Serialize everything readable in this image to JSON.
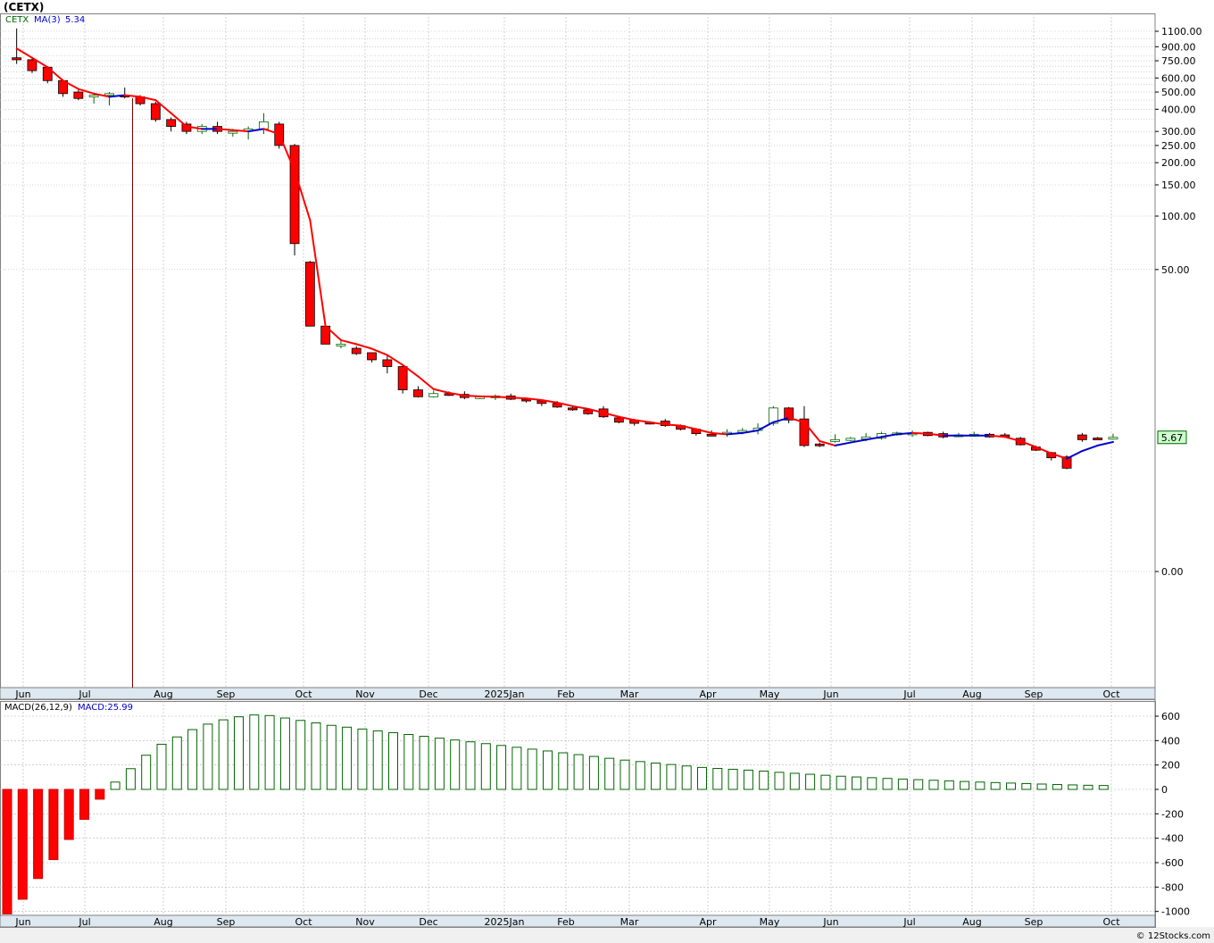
{
  "title": "(CETX)",
  "footer": "© 12Stocks.com",
  "colors": {
    "down": "#ff0000",
    "up": "#ffffff",
    "ma_down": "#ff0000",
    "ma_up": "#0000cc",
    "macd": "#006600",
    "grid": "#b4b4b4"
  },
  "price_legend": {
    "ticker": "CETX",
    "ma_label": "MA(3)",
    "ma_value": "5.34"
  },
  "macd_legend": {
    "label": "MACD(26,12,9)",
    "value_label": "MACD:25.99"
  },
  "last_price": "5.67",
  "chart_data": [
    {
      "type": "candlestick",
      "title": "(CETX)",
      "y_scale": "log",
      "y_ticks": [
        "1100.00",
        "900.00",
        "750.00",
        "600.00",
        "500.00",
        "400.00",
        "300.00",
        "250.00",
        "200.00",
        "150.00",
        "100.00",
        "50.00",
        "0.00"
      ],
      "x_ticks": [
        "Jun",
        "Jul",
        "Aug",
        "Sep",
        "Oct",
        "Nov",
        "Dec",
        "2025Jan",
        "Feb",
        "Mar",
        "Apr",
        "May",
        "Jun",
        "Jul",
        "Aug",
        "Sep",
        "Oct"
      ],
      "last_value": 5.67,
      "series": [
        {
          "name": "CETX",
          "candles": [
            [
              780,
              1140,
              720,
              760
            ],
            [
              760,
              770,
              640,
              660
            ],
            [
              690,
              700,
              560,
              580
            ],
            [
              580,
              590,
              470,
              490
            ],
            [
              500,
              520,
              450,
              460
            ],
            [
              470,
              490,
              430,
              480
            ],
            [
              480,
              500,
              420,
              490
            ],
            [
              480,
              530,
              460,
              470
            ],
            [
              470,
              480,
              420,
              430
            ],
            [
              430,
              440,
              340,
              350
            ],
            [
              350,
              360,
              300,
              320
            ],
            [
              330,
              340,
              290,
              300
            ],
            [
              300,
              330,
              290,
              320
            ],
            [
              320,
              340,
              290,
              300
            ],
            [
              300,
              310,
              280,
              300
            ],
            [
              300,
              320,
              270,
              310
            ],
            [
              310,
              380,
              290,
              340
            ],
            [
              330,
              340,
              240,
              250
            ],
            [
              250,
              255,
              60,
              70
            ],
            [
              55,
              56,
              24,
              24
            ],
            [
              24,
              24,
              19,
              19
            ],
            [
              19,
              20,
              18,
              19
            ],
            [
              18,
              18.5,
              16.5,
              16.8
            ],
            [
              17,
              17,
              15,
              15.5
            ],
            [
              15.5,
              16.5,
              13,
              14.2
            ],
            [
              14.2,
              14.5,
              10,
              10.5
            ],
            [
              10.5,
              11,
              9.5,
              9.6
            ],
            [
              9.6,
              10.4,
              9.5,
              10
            ],
            [
              10,
              10.3,
              9.7,
              9.9
            ],
            [
              9.9,
              10.3,
              9.3,
              9.5
            ],
            [
              9.5,
              9.7,
              9.3,
              9.6
            ],
            [
              9.5,
              9.9,
              9.2,
              9.7
            ],
            [
              9.7,
              10,
              9.2,
              9.3
            ],
            [
              9.3,
              9.5,
              8.9,
              9.1
            ],
            [
              9.1,
              9.3,
              8.5,
              8.8
            ],
            [
              8.8,
              9.1,
              8.3,
              8.4
            ],
            [
              8.3,
              8.5,
              8,
              8.1
            ],
            [
              8.1,
              8.2,
              7.6,
              7.7
            ],
            [
              8.2,
              8.5,
              7.3,
              7.4
            ],
            [
              7.3,
              7.5,
              6.8,
              6.9
            ],
            [
              7.1,
              7.2,
              6.6,
              6.8
            ],
            [
              6.9,
              7.0,
              6.7,
              6.8
            ],
            [
              7.0,
              7.2,
              6.5,
              6.6
            ],
            [
              6.6,
              6.7,
              6.2,
              6.3
            ],
            [
              6.3,
              6.4,
              5.8,
              5.95
            ],
            [
              5.9,
              6.2,
              5.8,
              5.85
            ],
            [
              5.9,
              6.3,
              5.7,
              6.05
            ],
            [
              6.05,
              6.4,
              5.9,
              6.2
            ],
            [
              6.2,
              6.8,
              5.9,
              6.4
            ],
            [
              6.8,
              8.5,
              6.6,
              8.3
            ],
            [
              8.3,
              8.4,
              6.8,
              7.1
            ],
            [
              7.2,
              8.5,
              5.0,
              5.1
            ],
            [
              5.2,
              5.3,
              5.0,
              5.1
            ],
            [
              5.4,
              5.9,
              5.3,
              5.5
            ],
            [
              5.45,
              5.7,
              5.4,
              5.6
            ],
            [
              5.55,
              6.0,
              5.4,
              5.7
            ],
            [
              5.6,
              6.1,
              5.5,
              5.95
            ],
            [
              5.9,
              6.1,
              5.8,
              6.0
            ],
            [
              5.9,
              6.2,
              5.7,
              6.0
            ],
            [
              6.05,
              6.1,
              5.75,
              5.8
            ],
            [
              5.95,
              6.1,
              5.6,
              5.7
            ],
            [
              5.8,
              6.0,
              5.7,
              5.85
            ],
            [
              5.85,
              6.1,
              5.75,
              5.9
            ],
            [
              5.9,
              6.0,
              5.65,
              5.7
            ],
            [
              5.85,
              6.0,
              5.7,
              5.75
            ],
            [
              5.6,
              5.7,
              5.1,
              5.15
            ],
            [
              5.0,
              5.1,
              4.75,
              4.8
            ],
            [
              4.65,
              4.7,
              4.2,
              4.35
            ],
            [
              4.4,
              4.5,
              3.75,
              3.8
            ],
            [
              5.85,
              6.0,
              5.35,
              5.5
            ],
            [
              5.62,
              5.7,
              5.5,
              5.6
            ],
            [
              5.55,
              5.95,
              5.5,
              5.67
            ]
          ],
          "ma3": [
            880,
            780,
            690,
            580,
            520,
            490,
            470,
            480,
            470,
            450,
            380,
            320,
            310,
            310,
            305,
            300,
            310,
            290,
            180,
            95,
            24,
            20,
            19,
            17.9,
            16.5,
            14.5,
            12.5,
            10.6,
            10.1,
            9.75,
            9.65,
            9.6,
            9.5,
            9.4,
            9.2,
            8.9,
            8.5,
            8.2,
            7.8,
            7.4,
            7.1,
            6.9,
            6.7,
            6.6,
            6.3,
            6.0,
            5.9,
            6.0,
            6.2,
            6.9,
            7.3,
            6.9,
            5.4,
            5.1,
            5.3,
            5.5,
            5.7,
            5.9,
            6.0,
            5.95,
            5.8,
            5.8,
            5.8,
            5.8,
            5.7,
            5.4,
            5.0,
            4.6,
            4.3,
            4.75,
            5.1,
            5.34
          ]
        }
      ]
    },
    {
      "type": "bar",
      "title": "MACD(26,12,9)",
      "y_ticks": [
        "600",
        "400",
        "200",
        "0",
        "-200",
        "-400",
        "-600",
        "-800",
        "-1000"
      ],
      "ylim": [
        -1000,
        650
      ],
      "x_ticks": [
        "Jun",
        "Jul",
        "Aug",
        "Sep",
        "Oct",
        "Nov",
        "Dec",
        "2025Jan",
        "Feb",
        "Mar",
        "Apr",
        "May",
        "Jun",
        "Jul",
        "Aug",
        "Sep",
        "Oct"
      ],
      "series": [
        {
          "name": "MACD",
          "values": [
            -1020,
            -900,
            -730,
            -575,
            -410,
            -245,
            -80,
            60,
            170,
            280,
            370,
            430,
            490,
            535,
            570,
            595,
            610,
            605,
            585,
            565,
            545,
            525,
            510,
            495,
            480,
            465,
            450,
            435,
            420,
            405,
            390,
            375,
            360,
            345,
            330,
            315,
            300,
            285,
            270,
            255,
            240,
            228,
            216,
            204,
            192,
            180,
            172,
            165,
            158,
            150,
            140,
            132,
            124,
            116,
            108,
            102,
            96,
            90,
            85,
            80,
            75,
            70,
            65,
            60,
            56,
            52,
            48,
            44,
            40,
            37,
            34,
            32
          ]
        }
      ]
    }
  ]
}
